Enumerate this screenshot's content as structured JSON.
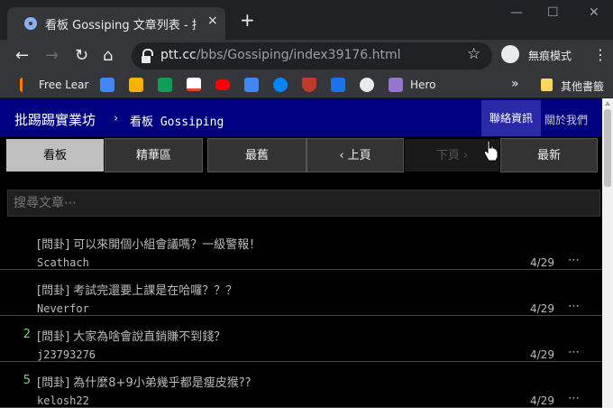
{
  "browser": {
    "tab_title": "看板 Gossiping 文章列表 - 批踢踢",
    "tab_close": "×",
    "new_tab": "+",
    "window_controls": [
      "—",
      "☐",
      "✕"
    ],
    "url_host": "ptt.cc",
    "url_path": "/bbs/Gossiping/index39176.html",
    "incognito_label": "無痕模式",
    "bookmarks": [
      {
        "label": "Free Lear",
        "icon": "free-learning-icon",
        "color": "#ff7a00"
      },
      {
        "icon": "google-docs-icon",
        "color": "#4285f4"
      },
      {
        "icon": "google-slides-icon",
        "color": "#f4b400"
      },
      {
        "icon": "google-sheets-icon",
        "color": "#0f9d58"
      },
      {
        "icon": "gmail-icon",
        "color": "#ea4335"
      },
      {
        "icon": "youtube-icon",
        "color": "#ff0000"
      },
      {
        "icon": "google-translate-icon",
        "color": "#4285f4"
      },
      {
        "icon": "messenger-icon",
        "color": "#0084ff"
      },
      {
        "icon": "crest-icon",
        "color": "#c0392b"
      },
      {
        "icon": "calendar-icon",
        "color": "#1a73e8"
      },
      {
        "icon": "github-icon",
        "color": "#e8eaed"
      },
      {
        "label": "Hero",
        "icon": "hero-icon",
        "color": "#9575cd"
      }
    ],
    "more_bookmarks": "»",
    "other_bookmarks": "其他書籤"
  },
  "site": {
    "name": "批踢踢實業坊",
    "breadcrumb_sep": "›",
    "board": "看板 Gossiping",
    "contact": "聯絡資訊",
    "about": "關於我們"
  },
  "nav": {
    "board": "看板",
    "digest": "精華區",
    "oldest": "最舊",
    "prev": "‹ 上頁",
    "next": "下頁 ›",
    "newest": "最新"
  },
  "search": {
    "placeholder": "搜尋文章⋯"
  },
  "entries": [
    {
      "nrec": "",
      "title": "[問卦] 可以來開個小組會議嗎？一級警報！",
      "author": "Scathach",
      "date": "4/29",
      "menu": "⋯"
    },
    {
      "nrec": "",
      "title": "[問卦] 考試完還要上課是在哈囉？？？",
      "author": "Neverfor",
      "date": "4/29",
      "menu": "⋯"
    },
    {
      "nrec": "2",
      "title": "[問卦] 大家為啥會說直銷賺不到錢？",
      "author": "j23793276",
      "date": "4/29",
      "menu": "⋯"
    },
    {
      "nrec": "5",
      "title": "[問卦] 為什麼8+9小弟幾乎都是瘦皮猴??",
      "author": "kelosh22",
      "date": "4/29",
      "menu": "⋯"
    }
  ],
  "colors": {
    "header_bg": "#000080",
    "recommend": "#79d979"
  }
}
